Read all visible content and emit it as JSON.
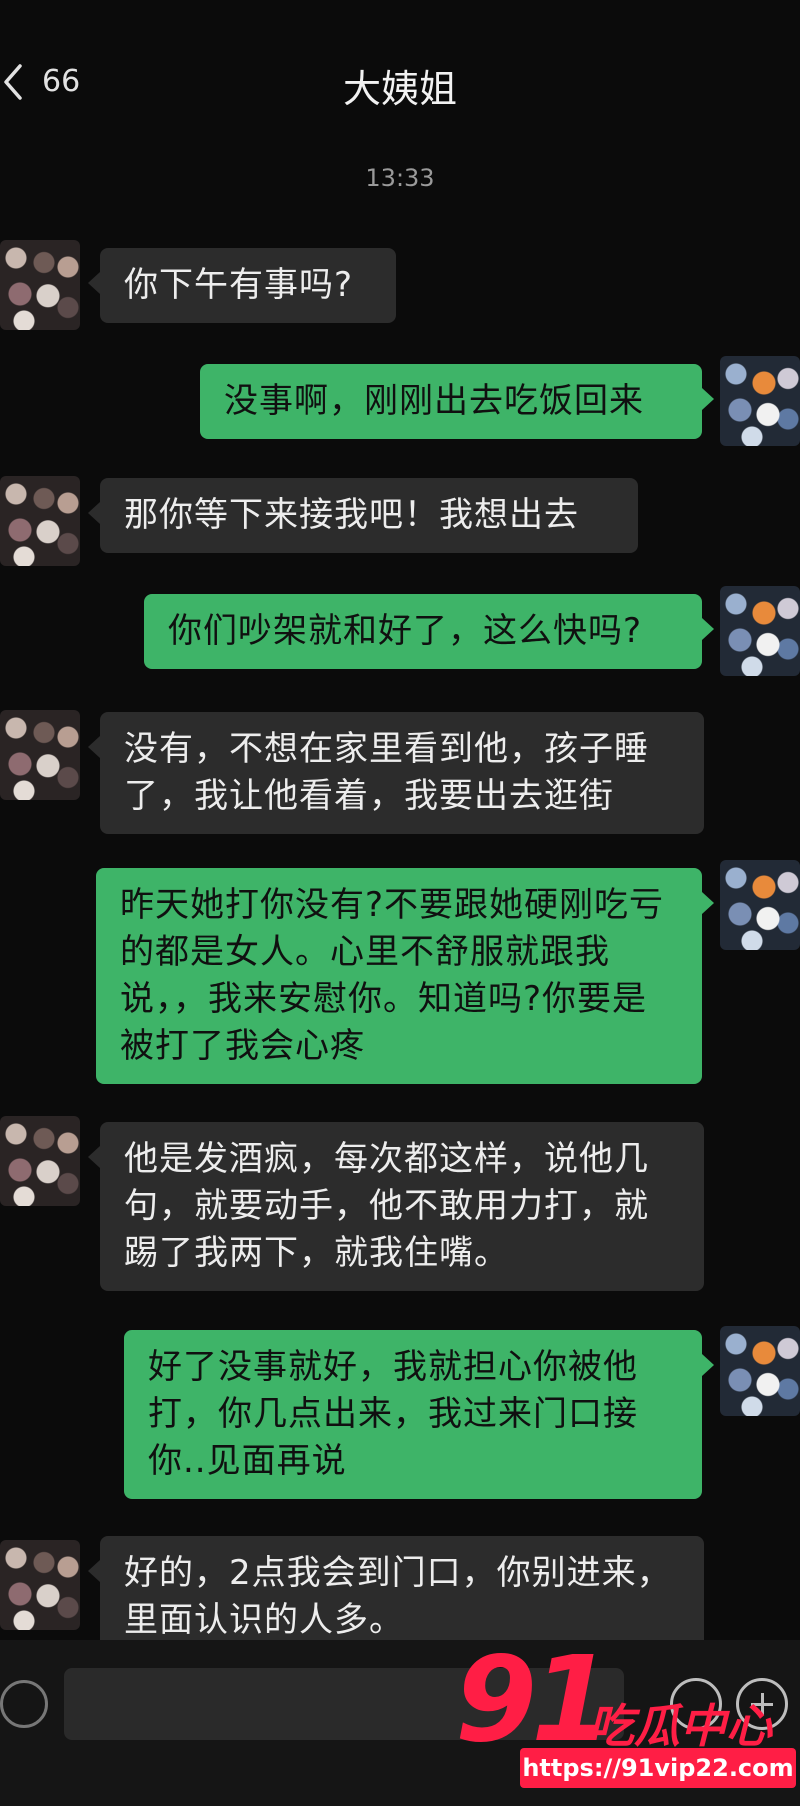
{
  "header": {
    "back_icon": "chevron-left-icon",
    "unread_count": "66",
    "title": "大姨姐"
  },
  "timestamp": "13:33",
  "messages": [
    {
      "from": "other",
      "text": "你下午有事吗?"
    },
    {
      "from": "self",
      "text": "没事啊，刚刚出去吃饭回来"
    },
    {
      "from": "other",
      "text": "那你等下来接我吧！我想出去"
    },
    {
      "from": "self",
      "text": "你们吵架就和好了，这么快吗?"
    },
    {
      "from": "other",
      "text": "没有，不想在家里看到他，孩子睡了，我让他看着，我要出去逛街"
    },
    {
      "from": "self",
      "text": "昨天她打你没有?不要跟她硬刚吃亏的都是女人。心里不舒服就跟我说，，我来安慰你。知道吗?你要是被打了我会心疼"
    },
    {
      "from": "other",
      "text": "他是发酒疯，每次都这样，说他几句，就要动手，他不敢用力打，就踢了我两下，就我住嘴。"
    },
    {
      "from": "self",
      "text": "好了没事就好，我就担心你被他打，你几点出来，我过来门口接你..见面再说"
    },
    {
      "from": "other",
      "text": "好的，2点我会到门口，你别进来，里面认识的人多。"
    }
  ],
  "input_bar": {
    "voice_icon": "voice-icon",
    "emoji_icon": "emoji-icon",
    "plus_icon": "plus-icon"
  },
  "watermark": {
    "number": "91",
    "brand": "吃瓜中心",
    "url": "https://91vip22.com"
  },
  "colors": {
    "background": "#0b0b0b",
    "incoming_bubble": "#2c2c2c",
    "outgoing_bubble": "#3eb468",
    "watermark": "#ff1e45"
  }
}
